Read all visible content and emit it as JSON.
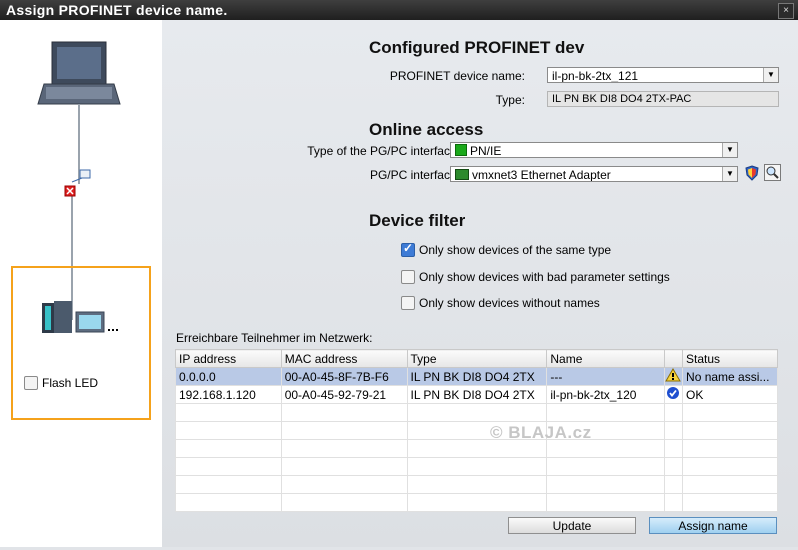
{
  "window": {
    "title": "Assign PROFINET device name.",
    "close_glyph": "×"
  },
  "left": {
    "flash_led_label": "Flash LED",
    "highlight_color": "#f5a21b"
  },
  "configured": {
    "heading": "Configured PROFINET dev",
    "device_name_label": "PROFINET device name:",
    "device_name_value": "il-pn-bk-2tx_121",
    "type_label": "Type:",
    "type_value": "IL PN BK DI8 DO4 2TX-PAC"
  },
  "online": {
    "heading": "Online access",
    "if_type_label": "Type of the PG/PC interface:",
    "if_type_value": "PN/IE",
    "if_label": "PG/PC interface:",
    "if_value": "vmxnet3 Ethernet Adapter"
  },
  "filter": {
    "heading": "Device filter",
    "opt_same_type": "Only show devices of the same type",
    "opt_bad_params": "Only show devices with bad parameter settings",
    "opt_no_names": "Only show devices without names"
  },
  "network": {
    "caption": "Erreichbare Teilnehmer im Netzwerk:",
    "columns": [
      "IP address",
      "MAC address",
      "Type",
      "Name",
      "",
      "Status"
    ],
    "rows": [
      [
        "0.0.0.0",
        "00-A0-45-8F-7B-F6",
        "IL PN BK DI8 DO4 2TX",
        "---",
        "",
        "No name assi..."
      ],
      [
        "192.168.1.120",
        "00-A0-45-92-79-21",
        "IL PN BK DI8 DO4 2TX",
        "il-pn-bk-2tx_120",
        "",
        "OK"
      ]
    ]
  },
  "watermark": "© BLAJA.cz",
  "buttons": {
    "update": "Update",
    "assign": "Assign name"
  }
}
